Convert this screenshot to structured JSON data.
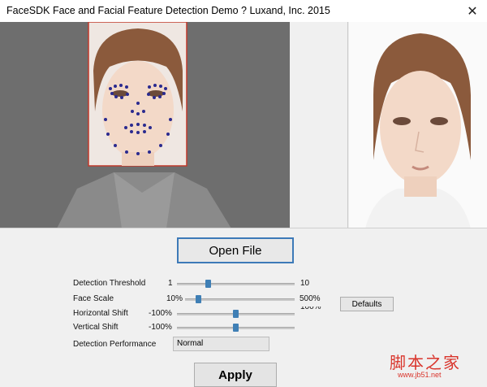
{
  "window": {
    "title": "FaceSDK Face and Facial Feature Detection Demo ? Luxand, Inc. 2015",
    "close_glyph": "✕"
  },
  "buttons": {
    "open_file": "Open File",
    "defaults": "Defaults",
    "apply": "Apply"
  },
  "controls": {
    "detection_threshold": {
      "label": "Detection Threshold",
      "min": "1",
      "max": "10",
      "value_fraction": 0.25
    },
    "face_scale": {
      "label": "Face Scale",
      "min": "10%",
      "max": "500%",
      "value_fraction": 0.1
    },
    "horizontal_shift": {
      "label": "Horizontal Shift",
      "min": "-100%",
      "max_partial": "100%",
      "value_fraction": 0.5
    },
    "vertical_shift": {
      "label": "Vertical Shift",
      "min": "-100%",
      "value_fraction": 0.5
    },
    "detection_performance": {
      "label": "Detection Performance",
      "selected": "Normal"
    }
  },
  "watermark": {
    "main": "脚本之家",
    "sub": "www.jb51.net"
  },
  "colors": {
    "accent": "#3d7ab8",
    "thumb": "#3f7fb5",
    "face_box": "#c0392b",
    "landmark": "#2a2a8f"
  }
}
